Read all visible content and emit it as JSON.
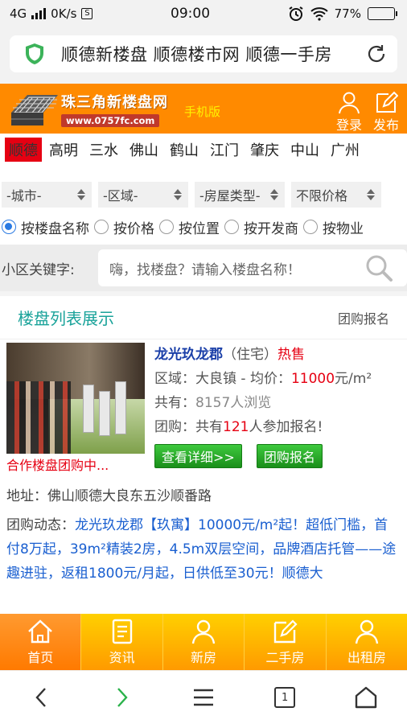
{
  "status": {
    "network": "4G",
    "speed": "0K/s",
    "s_icon": "S",
    "time": "09:00",
    "battery": "77%",
    "battery_level": 0.77
  },
  "browser": {
    "url_text": "顺德新楼盘 顺德楼市网 顺德一手房"
  },
  "header": {
    "logo_name": "珠三角新楼盘网",
    "logo_domain": "www.0757fc.com",
    "mobile_tag": "手机版",
    "login_label": "登录",
    "publish_label": "发布"
  },
  "cities": [
    "顺德",
    "高明",
    "三水",
    "佛山",
    "鹤山",
    "江门",
    "肇庆",
    "中山",
    "广州"
  ],
  "filters": [
    "-城市-",
    "-区域-",
    "-房屋类型-",
    "不限价格"
  ],
  "search_modes": [
    "按楼盘名称",
    "按价格",
    "按位置",
    "按开发商",
    "按物业"
  ],
  "search": {
    "label": "小区关键字:",
    "placeholder": "嗨，找楼盘？请输入楼盘名称！"
  },
  "section": {
    "title": "楼盘列表展示",
    "link": "团购报名"
  },
  "listing": {
    "name": "龙光玖龙郡",
    "type": "（住宅）",
    "status": "热售",
    "area_label": "区域：",
    "area": "大良镇",
    "price_label": " - 均价：",
    "price": "11000",
    "price_unit": "元/m²",
    "views_label": "共有：",
    "views": "8157人浏览",
    "group_label": "团购：",
    "group_pre": "共有",
    "group_count": "121",
    "group_post": "人参加报名!",
    "coop": "合作楼盘团购中...",
    "btn_detail": "查看详细>>",
    "btn_group": "团购报名",
    "address_label": "地址：",
    "address": "佛山顺德大良东五沙顺番路",
    "dynamic_label": "团购动态：",
    "dynamic": "龙光玖龙郡【玖寓】10000元/m²起！超低门槛，首付8万起，39m²精装2房，4.5m双层空间，品牌酒店托管——途趣进驻，返租1800元/月起，日供低至30元！顺德大"
  },
  "bottom_nav": [
    "首页",
    "资讯",
    "新房",
    "二手房",
    "出租房"
  ],
  "sysnav": {
    "tab_count": "1"
  },
  "colors": {
    "header_orange": "#ff8a00",
    "accent_teal": "#1aa39a",
    "price_red": "#e60012",
    "link_blue": "#1a5fd0"
  }
}
